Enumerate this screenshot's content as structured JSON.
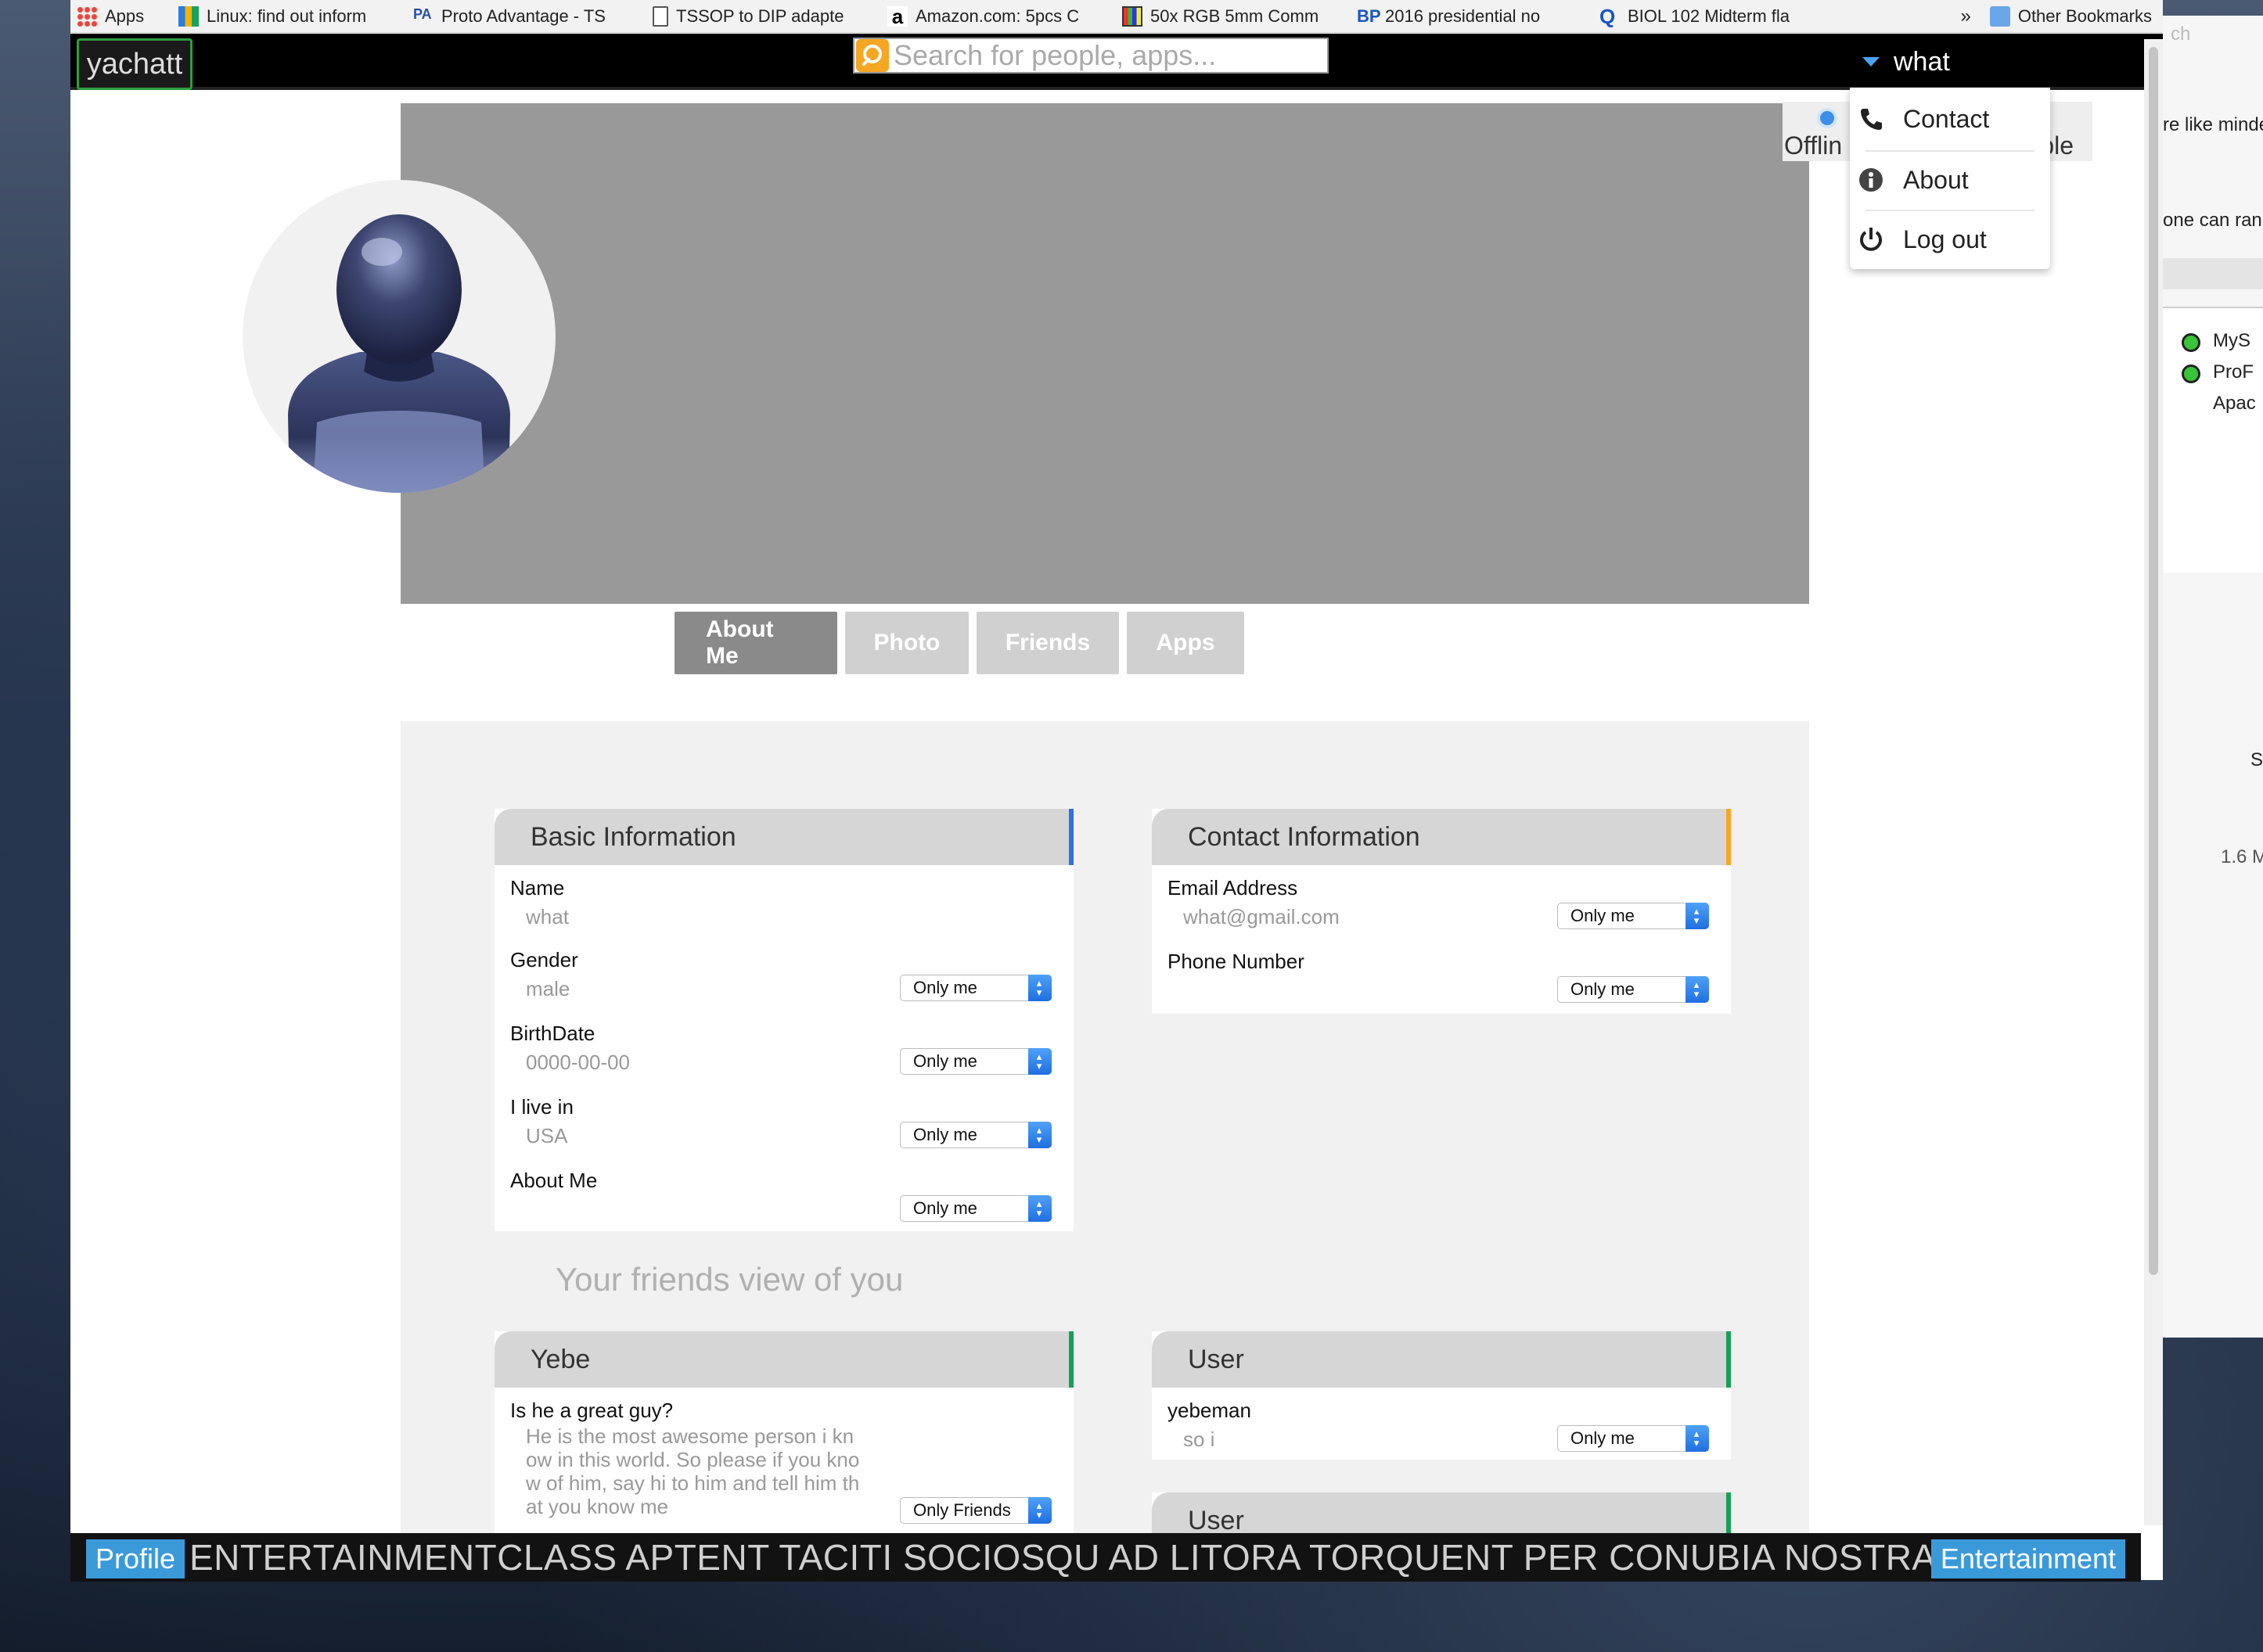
{
  "bookmarks": [
    {
      "label": "Apps",
      "icon": "apps-grid-icon"
    },
    {
      "label": "Linux: find out inform",
      "icon": "bookmark-grid-icon"
    },
    {
      "label": "Proto Advantage - TS",
      "icon": "pa-icon"
    },
    {
      "label": "TSSOP to DIP adapte",
      "icon": "document-icon"
    },
    {
      "label": "Amazon.com: 5pcs C",
      "icon": "amazon-icon"
    },
    {
      "label": "50x RGB 5mm Comm",
      "icon": "shop-icon"
    },
    {
      "label": "2016 presidential no",
      "icon": "bp-icon"
    },
    {
      "label": "BIOL 102 Midterm fla",
      "icon": "quizlet-icon"
    }
  ],
  "bookmarks_more": "»",
  "other_bookmarks": "Other Bookmarks",
  "app": {
    "logo": "yachatt",
    "search_placeholder": "Search for people, apps...",
    "username": "what"
  },
  "dropdown": {
    "items": [
      {
        "label": "Contact",
        "icon": "phone-icon"
      },
      {
        "label": "About",
        "icon": "info-icon"
      },
      {
        "label": "Log out",
        "icon": "power-icon"
      }
    ]
  },
  "status": {
    "left": "Offlin",
    "right": "ople"
  },
  "tabs": [
    {
      "label": "About Me",
      "active": true
    },
    {
      "label": "Photo",
      "active": false
    },
    {
      "label": "Friends",
      "active": false
    },
    {
      "label": "Apps",
      "active": false
    }
  ],
  "basic": {
    "title": "Basic Information",
    "fields": [
      {
        "label": "Name",
        "value": "what",
        "privacy": ""
      },
      {
        "label": "Gender",
        "value": "male",
        "privacy": "Only me"
      },
      {
        "label": "BirthDate",
        "value": "0000-00-00",
        "privacy": "Only me"
      },
      {
        "label": "I live in",
        "value": "USA",
        "privacy": "Only me"
      },
      {
        "label": "About Me",
        "value": "",
        "privacy": "Only me"
      }
    ]
  },
  "contact": {
    "title": "Contact Information",
    "fields": [
      {
        "label": "Email Address",
        "value": "what@gmail.com",
        "privacy": "Only me"
      },
      {
        "label": "Phone Number",
        "value": "",
        "privacy": "Only me"
      }
    ]
  },
  "friends_section_title": "Your friends view of you",
  "friend_card_1": {
    "title": "Yebe",
    "question": "Is he a great guy?",
    "answer": "He is the most awesome person i know in this world. So please if you know of him, say hi to him and tell him that you know me",
    "privacy": "Only Friends"
  },
  "friend_card_2": {
    "title": "User",
    "name": "yebeman",
    "value": "so i",
    "privacy": "Only me"
  },
  "friend_card_3": {
    "title": "User"
  },
  "ticker": {
    "left_button": "Profile",
    "text": "ENTERTAINMENTCLASS APTENT TACITI SOCIOSQU AD LITORA TORQUENT PER CONUBIA NOSTRA,",
    "right_button": "Entertainment"
  },
  "bg_window": {
    "lines": [
      "ch",
      "re like minde",
      "one can rank",
      "MyS",
      "ProF",
      "Apac",
      "S",
      "1.6 M"
    ]
  },
  "colors": {
    "basic_accent": "#2f6fe0",
    "contact_accent": "#f5a623",
    "friend_accent": "#15a05a",
    "ticker_button": "#3a9ad9",
    "logo_border": "#2e9e3a"
  }
}
